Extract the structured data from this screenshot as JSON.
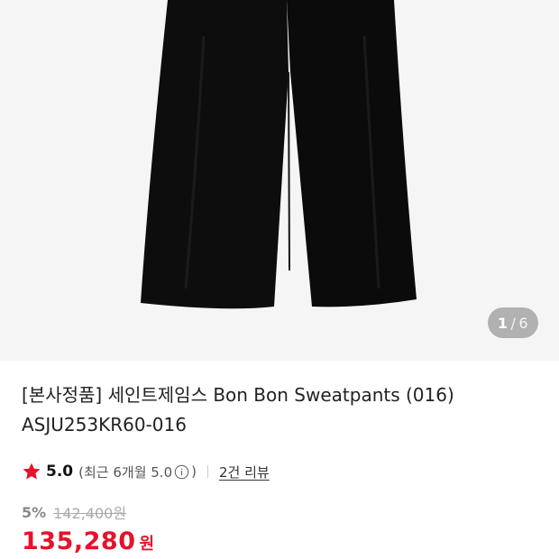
{
  "gallery": {
    "current_page": "1",
    "separator": "/",
    "total_pages": "6",
    "background": "#f5f5f5",
    "product_color": "#0c0c0c"
  },
  "product": {
    "title_line1": "[본사정품] 세인트제임스 Bon Bon Sweatpants (016)",
    "title_line2": "ASJU253KR60-016"
  },
  "rating": {
    "star_icon": "star-icon",
    "star_color": "#e5122c",
    "score": "5.0",
    "recent_open": "(최근 6개월 5.0",
    "info_icon": "info-circle-icon",
    "recent_close": ")",
    "review_link": "2건 리뷰"
  },
  "price": {
    "discount_rate": "5%",
    "original_price": "142,400원",
    "sale_price": "135,280",
    "currency": "원",
    "sale_color": "#e5122c"
  }
}
